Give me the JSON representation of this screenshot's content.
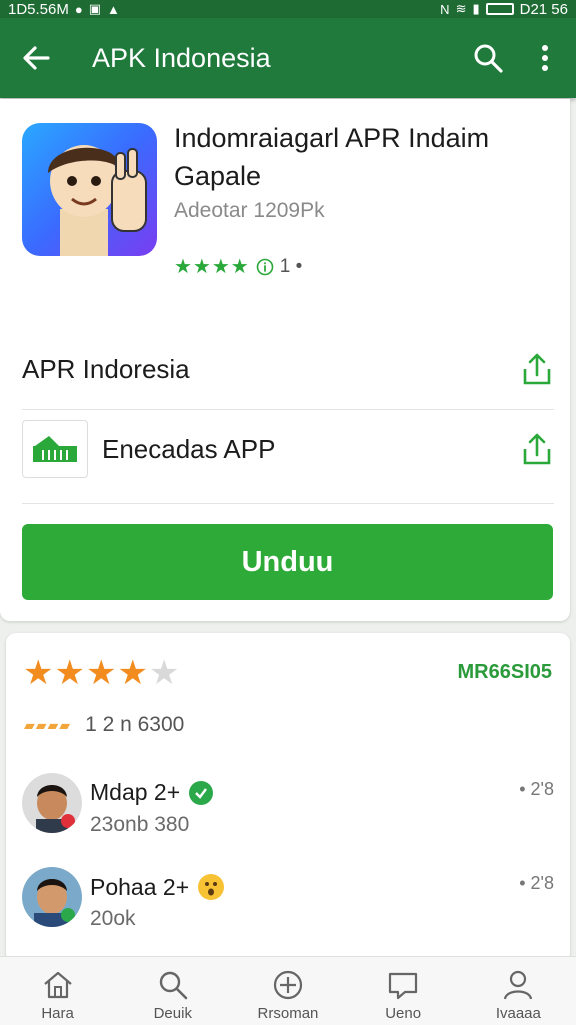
{
  "status_bar": {
    "left_time": "1D5.56M",
    "right_time": "D21 56"
  },
  "appbar": {
    "title": "APK Indonesia"
  },
  "app": {
    "name": "Indomraiagarl APR Indaim Gapale",
    "meta": "Adeotar 1209Pk",
    "rating_stars": 4,
    "rating_count": "1 •"
  },
  "rows": [
    {
      "label": "APR Indoresia"
    },
    {
      "label": "Enecadas APP"
    }
  ],
  "download_button": {
    "label": "Unduu"
  },
  "reviews": {
    "stars": 4,
    "code": "MR66SI05",
    "summary": "1 2  n 6300",
    "items": [
      {
        "name": "Mdap 2+",
        "sub": "23onb 380",
        "time": "• 2'8"
      },
      {
        "name": "Pohaa 2+",
        "sub": "20ok",
        "time": "• 2'8"
      }
    ]
  },
  "bottom_nav": [
    {
      "label": "Hara",
      "icon": "home-icon"
    },
    {
      "label": "Deuik",
      "icon": "search-icon"
    },
    {
      "label": "Rrsoman",
      "icon": "add-circle-icon"
    },
    {
      "label": "Ueno",
      "icon": "message-icon"
    },
    {
      "label": "Ivaaaa",
      "icon": "person-icon"
    }
  ],
  "colors": {
    "appbar": "#1f7a3c",
    "accent_green": "#2eaa38",
    "star_orange": "#f28c1e"
  }
}
